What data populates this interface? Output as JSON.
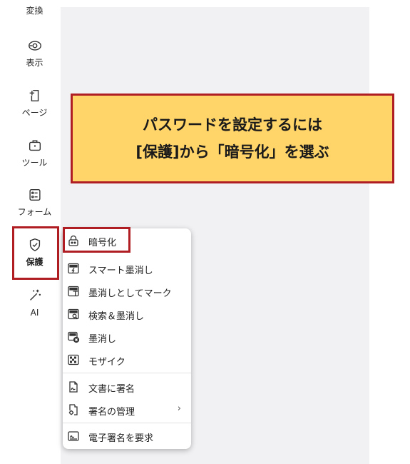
{
  "sidebar": {
    "items": [
      {
        "label": "変換",
        "icon": "convert-icon"
      },
      {
        "label": "表示",
        "icon": "eye-icon"
      },
      {
        "label": "ページ",
        "icon": "pages-icon"
      },
      {
        "label": "ツール",
        "icon": "toolbox-icon"
      },
      {
        "label": "フォーム",
        "icon": "form-icon"
      },
      {
        "label": "保護",
        "icon": "shield-check-icon"
      },
      {
        "label": "AI",
        "icon": "magic-wand-icon"
      }
    ]
  },
  "callout": {
    "line1": "パスワードを設定するには",
    "line2": "[保護]から「暗号化」を選ぶ"
  },
  "protect_menu": {
    "items": [
      {
        "label": "暗号化",
        "icon": "lock-icon"
      },
      {
        "label": "スマート墨消し",
        "icon": "smart-redact-icon"
      },
      {
        "label": "墨消しとしてマーク",
        "icon": "mark-redact-icon"
      },
      {
        "label": "検索＆墨消し",
        "icon": "search-redact-icon"
      },
      {
        "label": "墨消し",
        "icon": "apply-redact-icon"
      },
      {
        "label": "モザイク",
        "icon": "mosaic-icon"
      },
      {
        "label": "文書に署名",
        "icon": "sign-document-icon"
      },
      {
        "label": "署名の管理",
        "icon": "manage-signature-icon",
        "submenu": "›"
      },
      {
        "label": "電子署名を要求",
        "icon": "request-esign-icon"
      }
    ]
  },
  "colors": {
    "highlight": "#b01e23",
    "callout_bg": "#ffd56a",
    "canvas_bg": "#f1f1f3"
  }
}
